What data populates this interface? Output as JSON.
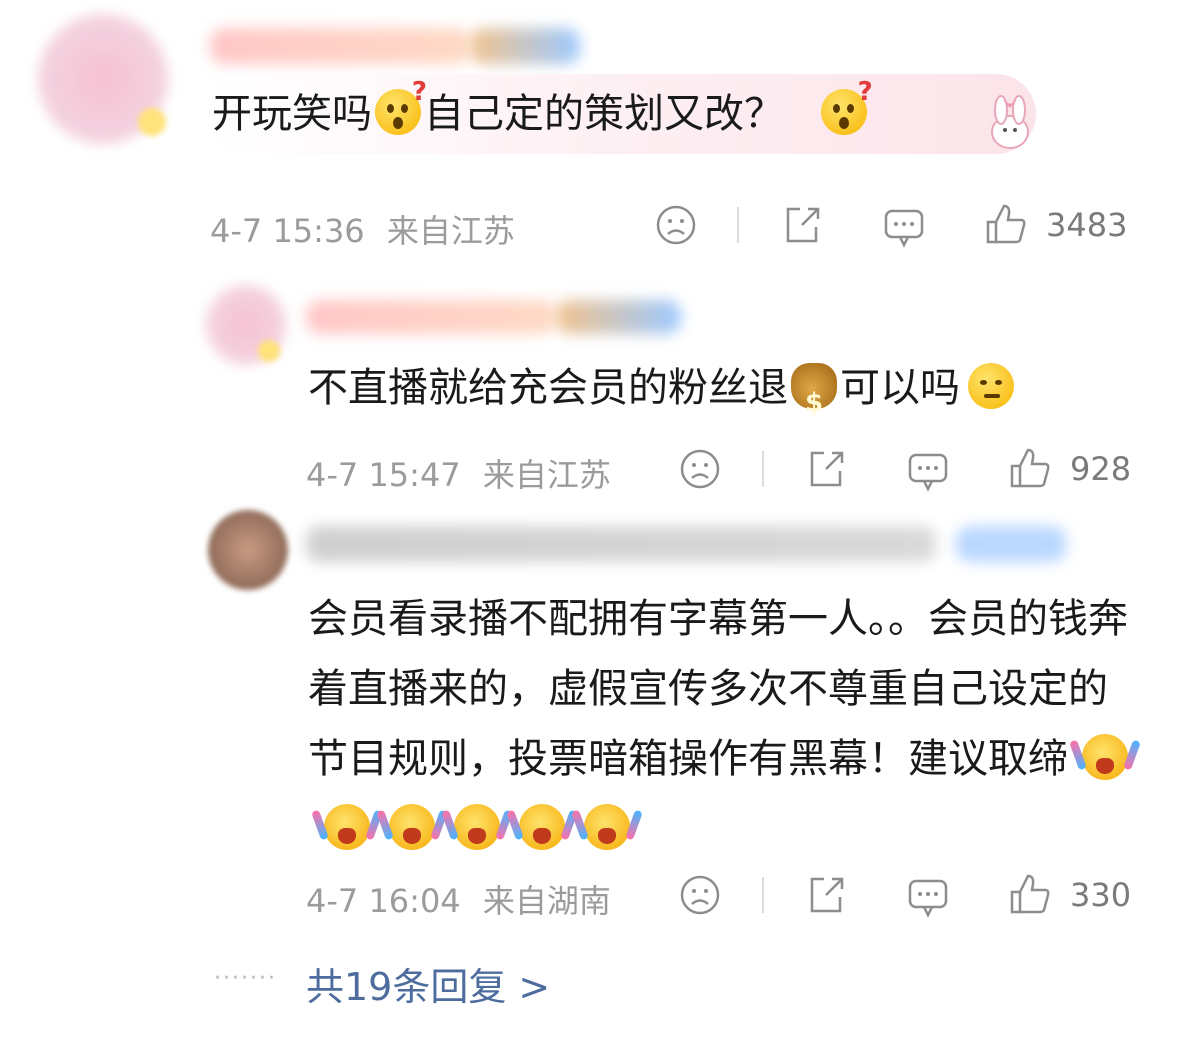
{
  "comments": [
    {
      "text_parts": [
        "开玩笑吗",
        "自己定的策划又改？"
      ],
      "emojis": [
        "thinking-question-emoji",
        "thinking-question-emoji"
      ],
      "time": "4-7 15:36",
      "location": "来自江苏",
      "likes": "3483"
    },
    {
      "text_parts": [
        "不直播就给充会员的粉丝退",
        "可以吗"
      ],
      "emojis": [
        "money-bag-emoji",
        "thinking-emoji"
      ],
      "time": "4-7 15:47",
      "location": "来自江苏",
      "likes": "928"
    },
    {
      "text": "会员看录播不配拥有字幕第一人。。会员的钱奔着直播来的，虚假宣传多次不尊重自己设定的节目规则，投票暗箱操作有黑幕！建议取缔",
      "emojis": [
        "cheering-cry-emoji",
        "cheering-cry-emoji",
        "cheering-cry-emoji",
        "cheering-cry-emoji",
        "cheering-cry-emoji",
        "cheering-cry-emoji"
      ],
      "time": "4-7 16:04",
      "location": "来自湖南",
      "likes": "330"
    }
  ],
  "replies": {
    "dots": "·······",
    "label": "共19条回复 >"
  },
  "colors": {
    "meta": "#9b9b9b",
    "link": "#4e6d9e",
    "bubble": "#fbe4ea"
  }
}
